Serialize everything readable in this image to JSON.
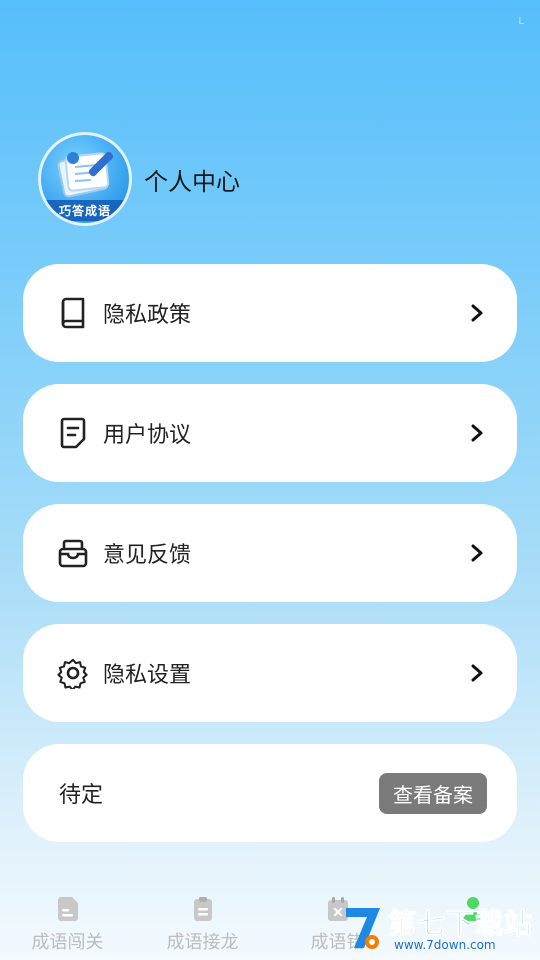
{
  "status": {
    "corner_mark": "L"
  },
  "profile": {
    "avatar_text": "巧答成语",
    "title": "个人中心"
  },
  "menu": [
    {
      "label": "隐私政策",
      "icon": "book-icon"
    },
    {
      "label": "用户协议",
      "icon": "document-icon"
    },
    {
      "label": "意见反馈",
      "icon": "inbox-icon"
    },
    {
      "label": "隐私设置",
      "icon": "gear-icon"
    }
  ],
  "pending": {
    "label": "待定",
    "button_label": "查看备案"
  },
  "tabs": [
    {
      "label": "成语闯关",
      "icon": "doc-tab-icon"
    },
    {
      "label": "成语接龙",
      "icon": "clipboard-tab-icon"
    },
    {
      "label": "成语错",
      "icon": "calendar-tab-icon"
    },
    {
      "label": "",
      "icon": "user-tab-icon"
    }
  ],
  "watermark": {
    "text": "第七下载站",
    "url": "www.7down.com"
  },
  "colors": {
    "accent": "#56BEFB",
    "tab_inactive": "#BDBDBD",
    "tab_active": "#4CD964",
    "button_gray": "#7A7A7A"
  }
}
